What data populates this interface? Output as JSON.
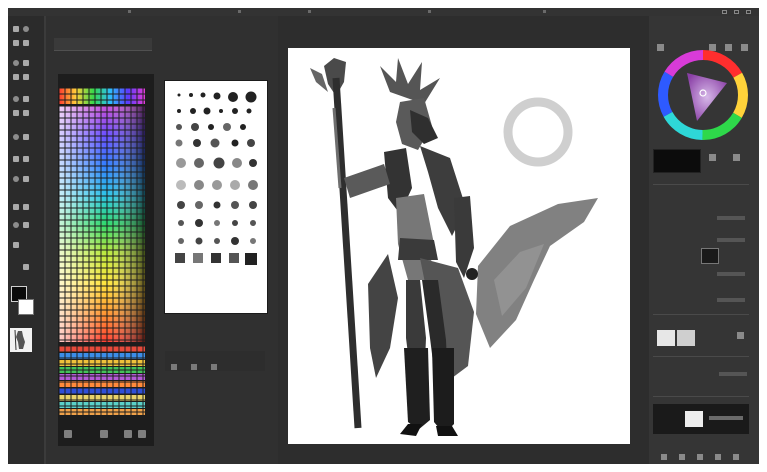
{
  "app": {
    "theme": "dark",
    "colors": {
      "chrome": "#3b3b3b",
      "toolbar": "#2b2b2b",
      "panel": "#303030",
      "canvas_bg": "#2d2d2d",
      "artboard": "#ffffff",
      "foreground_color": "#0b0b0b",
      "background_color": "#ffffff"
    }
  },
  "toolbar": {
    "tools": [
      "move-icon",
      "marquee-icon",
      "lasso-icon",
      "magic-wand-icon",
      "crop-icon",
      "eyedropper-icon",
      "heal-icon",
      "brush-icon",
      "stamp-icon",
      "history-brush-icon",
      "eraser-icon",
      "gradient-icon",
      "blur-icon",
      "dodge-icon",
      "pen-icon",
      "type-icon",
      "path-select-icon",
      "shape-icon",
      "hand-icon",
      "zoom-icon"
    ]
  },
  "swatches_panel": {
    "icons": [
      "new-swatch-icon",
      "folder-icon",
      "delete-icon"
    ]
  },
  "brush_panel": {
    "icons": [
      "brush-settings-icon",
      "new-brush-icon",
      "delete-brush-icon"
    ]
  },
  "color_wheel": {
    "current_color": "#a05ab8"
  },
  "layers_panel": {
    "icons": [
      "eye-icon",
      "link-icon",
      "fx-icon",
      "mask-icon",
      "group-icon",
      "new-layer-icon",
      "trash-icon"
    ]
  }
}
